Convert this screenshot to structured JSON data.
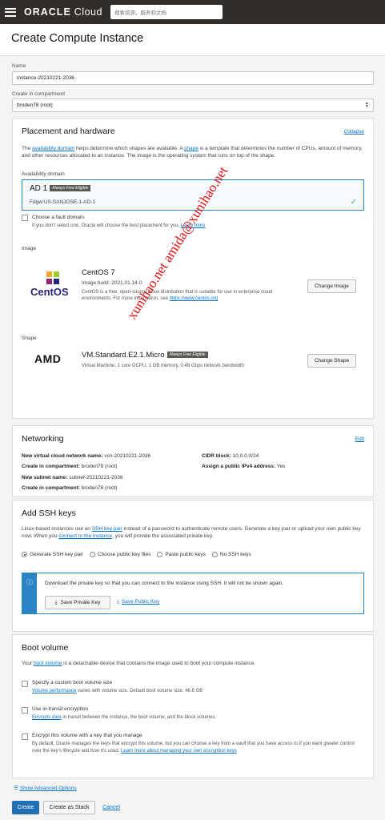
{
  "topbar": {
    "logo_oracle": "ORACLE",
    "logo_cloud": "Cloud",
    "search_placeholder": "搜索资源，服务和文档"
  },
  "page": {
    "title": "Create Compute Instance"
  },
  "name_field": {
    "label": "Name",
    "value": "instance-20210221-2036"
  },
  "compartment_field": {
    "label": "Create in compartment",
    "value": "broden78 (root)"
  },
  "placement": {
    "title": "Placement and hardware",
    "collapse": "Collapse",
    "desc_1": "The ",
    "desc_link_ad": "availability domain",
    "desc_2": " helps determine which shapes are available. A ",
    "desc_link_shape": "shape",
    "desc_3": " is a template that determines the number of CPUs, amount of memory, and other resources allocated to an instance. The image is the operating system that runs on top of the shape.",
    "ad_label": "Availability domain",
    "ad_name": "AD 1",
    "ad_badge": "Always Free Eligible",
    "ad_value": "Fdgw:US-SANJOSE-1-AD-1",
    "fault_domain_label": "Choose a fault domain",
    "fault_domain_help_1": "If you don't select one, Oracle will choose the best placement for you. ",
    "fault_domain_help_link": "Learn more",
    "image_label": "Image",
    "image_logo": "CentOS",
    "image_name": "CentOS 7",
    "image_build": "Image build: 2021.01.14-0",
    "image_desc": "CentOS is a free, open-source Linux distribution that is suitable for use in enterprise cloud environments. For more information, see ",
    "image_link": "https://www.centos.org",
    "change_image": "Change Image",
    "shape_label": "Shape",
    "shape_logo": "AMD",
    "shape_name": "VM.Standard.E2.1.Micro",
    "shape_badge": "Always Free Eligible",
    "shape_desc": "Virtual Machine, 1 core OCPU, 1 GB memory, 0.48 Gbps network bandwidth",
    "change_shape": "Change Shape"
  },
  "networking": {
    "title": "Networking",
    "edit": "Edit",
    "vcn_label": "New virtual cloud network name:",
    "vcn_value": "vcn-20210221-2036",
    "cidr_label": "CIDR block:",
    "cidr_value": "10.0.0.0/24",
    "comp1_label": "Create in compartment:",
    "comp1_value": "broden78 (root)",
    "ipv4_label": "Assign a public IPv4 address:",
    "ipv4_value": "Yes",
    "subnet_label": "New subnet name:",
    "subnet_value": "subnet-20210221-2036",
    "comp2_label": "Create in compartment:",
    "comp2_value": "broden78 (root)"
  },
  "ssh": {
    "title": "Add SSH keys",
    "desc_1": "Linux-based instances use an ",
    "desc_link_pair": "SSH key pair",
    "desc_2": " instead of a password to authenticate remote users. Generate a key pair or upload your own public key now. When you ",
    "desc_link_connect": "connect to the instance",
    "desc_3": ", you will provide the associated private key.",
    "options": [
      "Generate SSH key pair",
      "Choose public key files",
      "Paste public keys",
      "No SSH keys"
    ],
    "info_text": "Download the private key so that you can connect to the instance using SSH. It will not be shown again.",
    "save_private": "Save Private Key",
    "save_public": "Save Public Key"
  },
  "boot": {
    "title": "Boot volume",
    "desc_1": "Your ",
    "desc_link": "boot volume",
    "desc_2": " is a detachable device that contains the image used to boot your compute instance.",
    "opt1_label": "Specify a custom boot volume size",
    "opt1_link": "Volume performance",
    "opt1_help": " varies with volume size. Default boot volume size: 46.6 GB",
    "opt2_label": "Use in-transit encryption",
    "opt2_link": "Encrypts data",
    "opt2_help": " in transit between the instance, the boot volume, and the block volumes.",
    "opt3_label": "Encrypt this volume with a key that you manage",
    "opt3_help_a": "By default, Oracle manages the keys that encrypt this volume, but you can choose a key from a vault that you have access to if you want greater control",
    "opt3_help_b": "over the key's lifecycle and how it's used. ",
    "opt3_link": "Learn more about managing your own encryption keys"
  },
  "advanced": "Show Advanced Options",
  "actions": {
    "create": "Create",
    "create_stack": "Create as Stack",
    "cancel": "Cancel"
  },
  "watermark": "xunihao.net amida@xunihao.net",
  "colors": {
    "accent": "#0572ce",
    "primary_button": "#1f6fb6",
    "topbar": "#312d2a",
    "watermark": "#e21010"
  }
}
